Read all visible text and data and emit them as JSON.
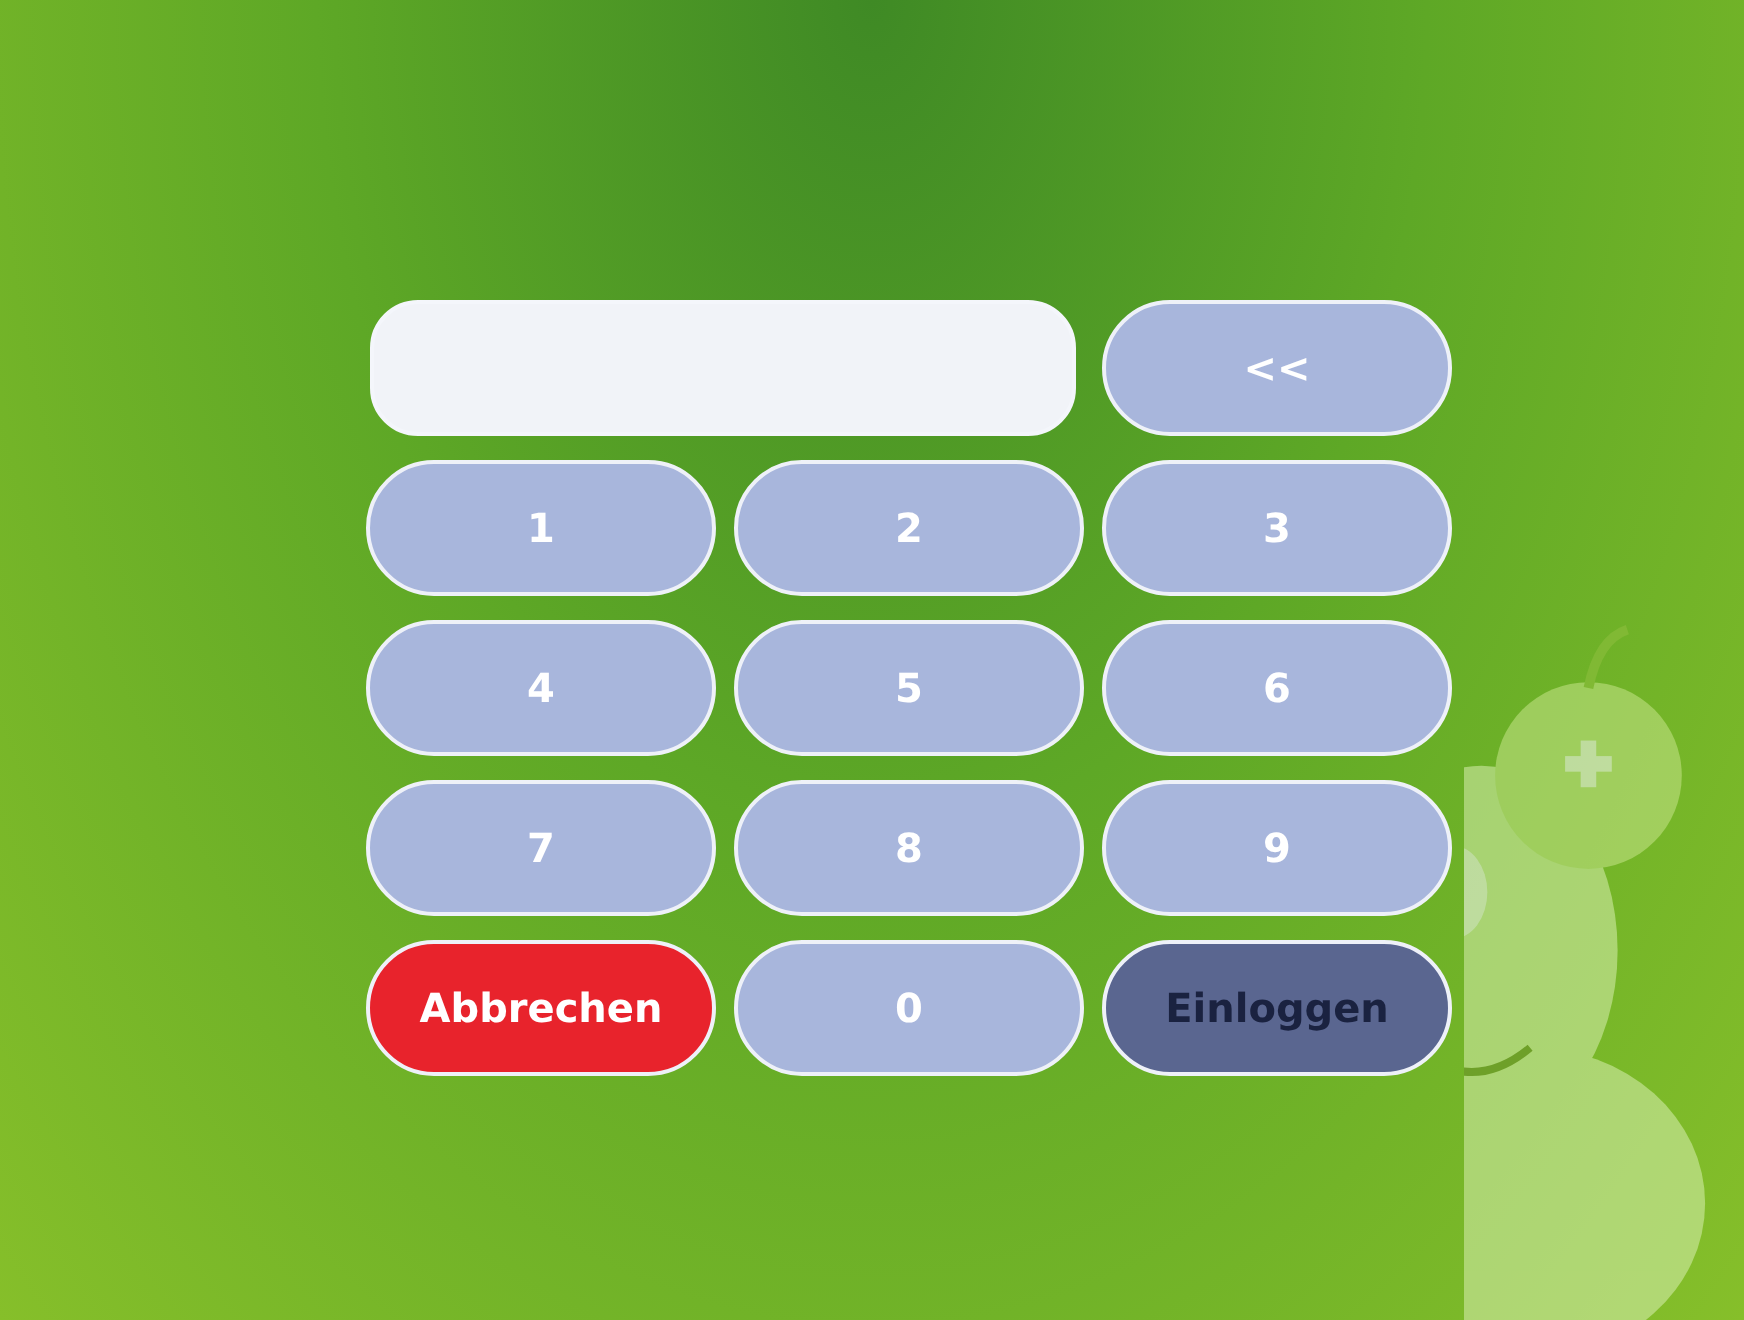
{
  "keypad": {
    "keys": [
      {
        "label": "<<",
        "kind": "back"
      },
      {
        "label": "1",
        "kind": "digit"
      },
      {
        "label": "2",
        "kind": "digit"
      },
      {
        "label": "3",
        "kind": "digit"
      },
      {
        "label": "4",
        "kind": "digit"
      },
      {
        "label": "5",
        "kind": "digit"
      },
      {
        "label": "6",
        "kind": "digit"
      },
      {
        "label": "7",
        "kind": "digit"
      },
      {
        "label": "8",
        "kind": "digit"
      },
      {
        "label": "9",
        "kind": "digit"
      },
      {
        "label": "Abbrechen",
        "kind": "cancel"
      },
      {
        "label": "0",
        "kind": "digit"
      },
      {
        "label": "Einloggen",
        "kind": "login"
      }
    ]
  }
}
